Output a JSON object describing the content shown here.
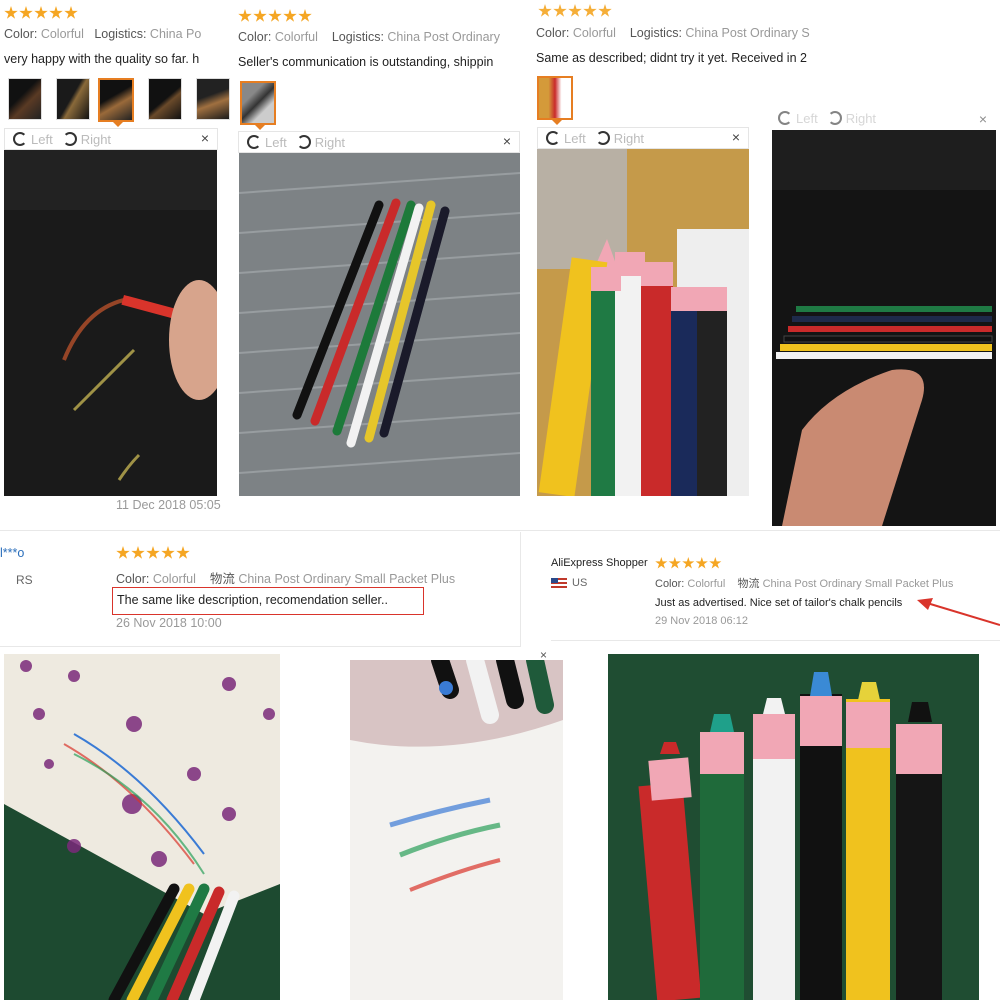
{
  "reviews_top": [
    {
      "color_label": "Color:",
      "color_value": "Colorful",
      "logistics_label": "Logistics:",
      "logistics_value": "China Po",
      "text": "very happy with the quality so far. h",
      "date": "11 Dec 2018 05:05"
    },
    {
      "color_label": "Color:",
      "color_value": "Colorful",
      "logistics_label": "Logistics:",
      "logistics_value": "China Post Ordinary",
      "text": "Seller's communication is outstanding, shippin"
    },
    {
      "color_label": "Color:",
      "color_value": "Colorful",
      "logistics_label": "Logistics:",
      "logistics_value": "China Post Ordinary S",
      "text": "Same as described; didnt try it yet. Received in 2"
    }
  ],
  "rotate": {
    "left": "Left",
    "right": "Right",
    "close": "×"
  },
  "review_mid_left": {
    "user": "l***o",
    "country": "RS",
    "color_label": "Color:",
    "color_value": "Colorful",
    "logistics_label": "物流",
    "logistics_value": "China Post Ordinary Small Packet Plus",
    "text": "The same like description, recomendation seller..",
    "date": "26 Nov 2018 10:00"
  },
  "review_mid_right": {
    "user": "AliExpress Shopper",
    "country": "US",
    "color_label": "Color:",
    "color_value": "Colorful",
    "logistics_label": "物流",
    "logistics_value": "China Post Ordinary Small Packet Plus",
    "text": "Just as advertised. Nice set of tailor's chalk pencils",
    "date": "29 Nov 2018 06:12"
  },
  "colors": {
    "star": "#f5a623",
    "highlight_box": "#d9342b",
    "arrow": "#d9342b",
    "link_blue": "#2a6ebb"
  }
}
